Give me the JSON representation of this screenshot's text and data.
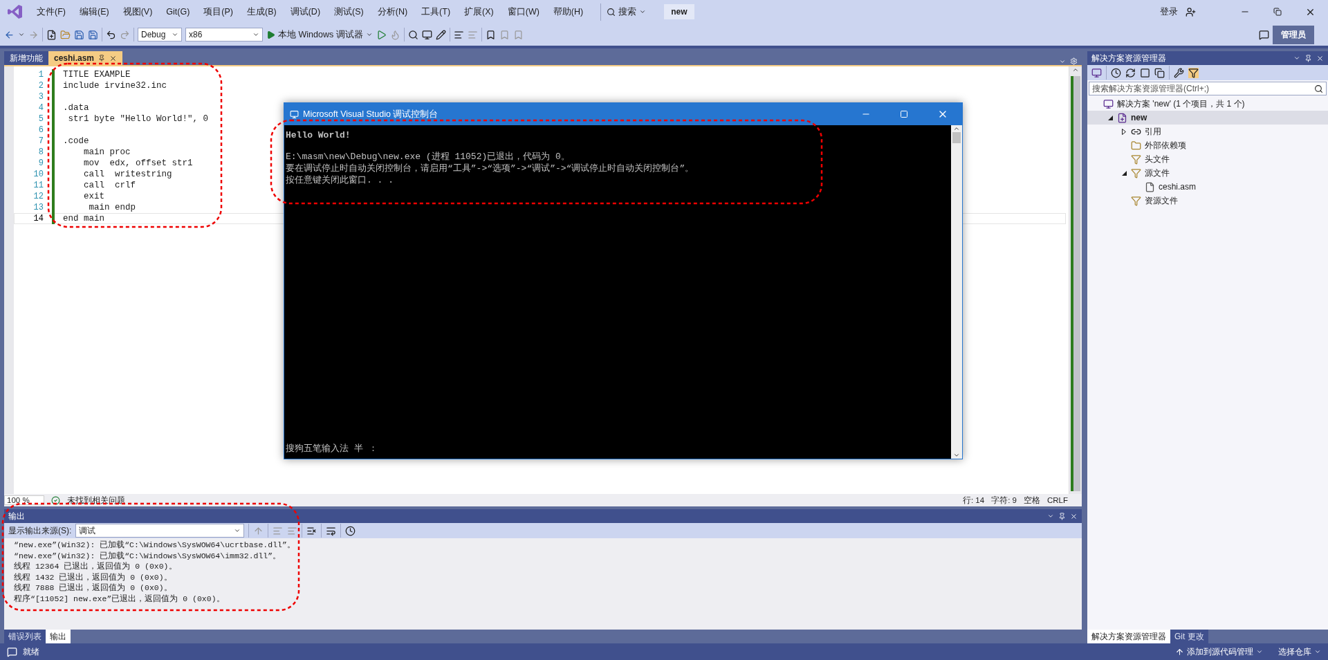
{
  "menu": [
    "文件(F)",
    "编辑(E)",
    "视图(V)",
    "Git(G)",
    "项目(P)",
    "生成(B)",
    "调试(D)",
    "测试(S)",
    "分析(N)",
    "工具(T)",
    "扩展(X)",
    "窗口(W)",
    "帮助(H)"
  ],
  "search_label": "搜索",
  "solution_badge": "new",
  "account": {
    "sign_in": "登录",
    "admin": "管理员"
  },
  "toolbar": {
    "config": "Debug",
    "platform": "x86",
    "run": "本地 Windows 调试器"
  },
  "doc_tabs": [
    {
      "label": "新增功能",
      "selected": false
    },
    {
      "label": "ceshi.asm",
      "selected": true
    }
  ],
  "editor": {
    "lines": [
      {
        "number": "1",
        "text": "TITLE EXAMPLE",
        "current": false
      },
      {
        "number": "2",
        "text": "include irvine32.inc",
        "current": false
      },
      {
        "number": "3",
        "current": false
      },
      {
        "number": "4",
        "text": ".data",
        "current": false
      },
      {
        "number": "5",
        "text": " str1 byte \"Hello World!\", 0",
        "current": false
      },
      {
        "number": "6",
        "current": false
      },
      {
        "number": "7",
        "text": ".code",
        "current": false
      },
      {
        "number": "8",
        "text": "    main proc",
        "current": false
      },
      {
        "number": "9",
        "text": "    mov  edx, offset str1",
        "current": false
      },
      {
        "number": "10",
        "text": "    call  writestring",
        "current": false
      },
      {
        "number": "11",
        "text": "    call  crlf",
        "current": false
      },
      {
        "number": "12",
        "text": "    exit",
        "current": false
      },
      {
        "number": "13",
        "text": "     main endp",
        "current": false
      },
      {
        "number": "14",
        "text": "end main",
        "current": true
      }
    ],
    "status": {
      "zoom": "100 %",
      "issues": "未找到相关问题",
      "line": "行: 14",
      "char": "字符: 9",
      "indent": "空格",
      "eol": "CRLF"
    }
  },
  "console": {
    "title": "Microsoft Visual Studio 调试控制台",
    "blocks": [
      [
        "Hello World!"
      ],
      [
        "E:\\masm\\new\\Debug\\new.exe (进程 11052)已退出，代码为 0。",
        "要在调试停止时自动关闭控制台，请启用“工具”->“选项”->“调试”->“调试停止时自动关闭控制台”。",
        "按任意键关闭此窗口. . ."
      ]
    ],
    "ime": "搜狗五笔输入法 半 ："
  },
  "output": {
    "title": "输出",
    "source_label": "显示输出来源(S):",
    "source": "调试",
    "lines": [
      "“new.exe”(Win32): 已加载“C:\\Windows\\SysWOW64\\ucrtbase.dll”。",
      "“new.exe”(Win32): 已加载“C:\\Windows\\SysWOW64\\imm32.dll”。",
      "线程 12364 已退出，返回值为 0 (0x0)。",
      "线程 1432 已退出，返回值为 0 (0x0)。",
      "线程 7888 已退出，返回值为 0 (0x0)。",
      "程序“[11052] new.exe”已退出，返回值为 0 (0x0)。"
    ]
  },
  "bottom_tabs": [
    {
      "label": "错误列表",
      "selected": false
    },
    {
      "label": "输出",
      "selected": true
    }
  ],
  "solution_explorer": {
    "title": "解决方案资源管理器",
    "search_placeholder": "搜索解决方案资源管理器(Ctrl+;)",
    "tree": [
      {
        "label": "解决方案 'new' (1 个项目，共 1 个)",
        "kind": "solution",
        "selected": false,
        "children": [
          {
            "label": "new",
            "kind": "project",
            "selected": true,
            "expanded": true,
            "children": [
              {
                "label": "引用",
                "kind": "references",
                "selected": false,
                "expanded": false
              },
              {
                "label": "外部依赖项",
                "kind": "external",
                "selected": false
              },
              {
                "label": "头文件",
                "kind": "filter",
                "selected": false
              },
              {
                "label": "源文件",
                "kind": "filter",
                "selected": false,
                "expanded": true,
                "children": [
                  {
                    "label": "ceshi.asm",
                    "kind": "file",
                    "selected": false
                  }
                ]
              },
              {
                "label": "资源文件",
                "kind": "filter",
                "selected": false
              }
            ]
          }
        ]
      }
    ],
    "tabs": [
      {
        "label": "解决方案资源管理器",
        "selected": true
      },
      {
        "label": "Git 更改",
        "selected": false
      }
    ]
  },
  "status_bar": {
    "ready": "就绪",
    "source_control": "添加到源代码管理",
    "repo": "选择仓库"
  }
}
